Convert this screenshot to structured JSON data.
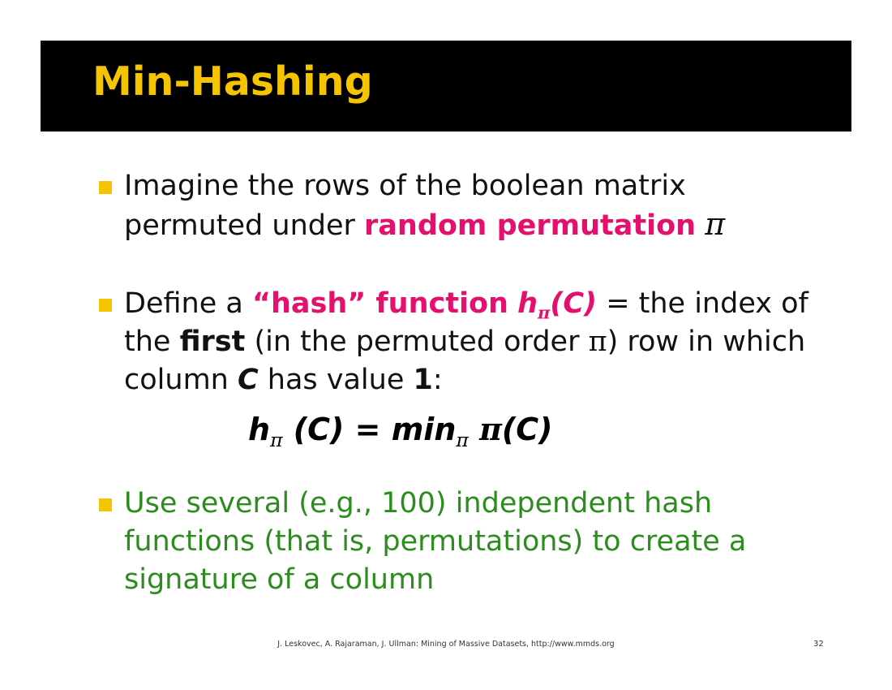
{
  "title": "Min-Hashing",
  "colors": {
    "title_bar": "#000000",
    "title_text": "#f5c400",
    "bullet_marker": "#f5c400",
    "highlight_pink": "#e4106e",
    "green_text": "#2c8c1e"
  },
  "bullet1": {
    "line1": "Imagine the rows of the boolean matrix",
    "line2_pre": "permuted under ",
    "highlight": "random permutation",
    "pi": "π"
  },
  "bullet2": {
    "pre": "Define a ",
    "hash_quoted": "“hash” function",
    "h": "h",
    "sub": "π",
    "arg": "(C)",
    "eq_text": " = the index of the ",
    "first": "first",
    "mid": " (in the permuted order ",
    "pi": "π",
    "mid2": ") row in which column ",
    "col": "C",
    "mid3": " has value ",
    "one": "1",
    "colon": ":"
  },
  "formula": {
    "h": "h",
    "sub1": "π",
    "lhs_arg": " (C) = min",
    "sub2": "π",
    "space": " ",
    "pi": "π",
    "rhs_arg": "(C)"
  },
  "bullet3": {
    "text": "Use several (e.g., 100) independent hash functions (that is, permutations) to create a signature of a column"
  },
  "footer": {
    "citation": "J. Leskovec, A. Rajaraman, J. Ullman: Mining of Massive Datasets, http://www.mmds.org",
    "page_number": "32"
  }
}
